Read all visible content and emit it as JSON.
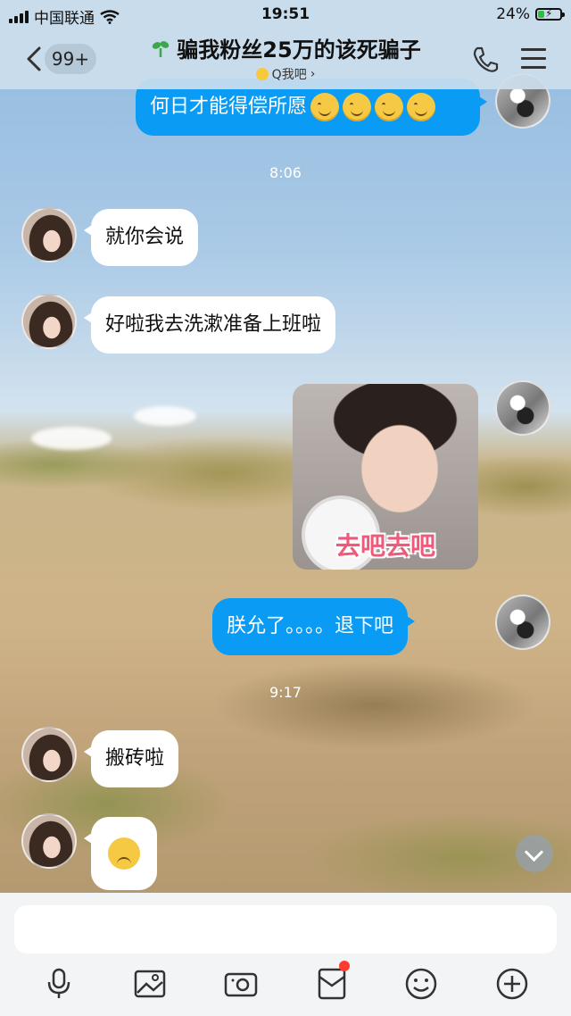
{
  "status_bar": {
    "carrier": "中国联通",
    "time": "19:51",
    "battery": "24%"
  },
  "header": {
    "unread_badge": "99+",
    "title": "骗我粉丝25万的该死骗子",
    "subtitle": "Q我吧"
  },
  "messages": [
    {
      "direction": "out",
      "text": "何日才能得偿所愿"
    },
    {
      "type": "timestamp",
      "text": "8:06"
    },
    {
      "direction": "in",
      "text": "就你会说"
    },
    {
      "direction": "in",
      "text": "好啦我去洗漱准备上班啦"
    },
    {
      "direction": "out",
      "type": "sticker",
      "caption": "去吧去吧"
    },
    {
      "direction": "out",
      "text": "朕允了。。。。退下吧"
    },
    {
      "type": "timestamp",
      "text": "9:17"
    },
    {
      "direction": "in",
      "text": "搬砖啦"
    },
    {
      "direction": "in",
      "type": "emoji",
      "icon": "disappointed-face-icon"
    }
  ],
  "input": {
    "placeholder": ""
  },
  "toolbar": [
    "microphone-icon",
    "image-icon",
    "camera-icon",
    "red-packet-icon",
    "emoji-icon",
    "plus-icon"
  ],
  "colors": {
    "outgoing_bubble": "#0a9cf5",
    "incoming_bubble": "#ffffff",
    "notification_dot": "#ff3b30"
  }
}
